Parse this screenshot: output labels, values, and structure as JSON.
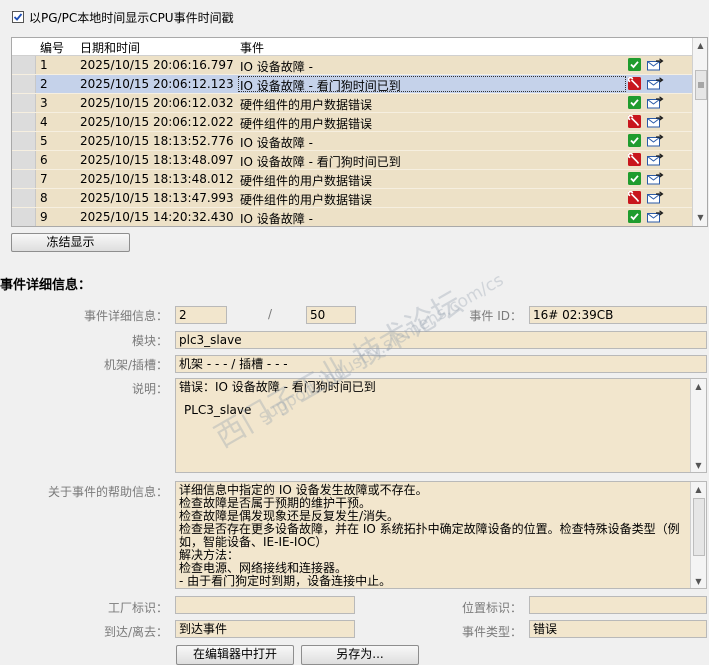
{
  "top_checkbox": {
    "label": "以PG/PC本地时间显示CPU事件时间戳",
    "checked": true
  },
  "table": {
    "columns": [
      "编号",
      "日期和时间",
      "事件"
    ],
    "selected_index": 1,
    "rows": [
      {
        "num": "1",
        "datetime": "2025/10/15 20:06:16.797",
        "event": "IO 设备故障 -",
        "status": "ok"
      },
      {
        "num": "2",
        "datetime": "2025/10/15 20:06:12.123",
        "event": "IO 设备故障 - 看门狗时间已到",
        "status": "error"
      },
      {
        "num": "3",
        "datetime": "2025/10/15 20:06:12.032",
        "event": "硬件组件的用户数据错误",
        "status": "ok"
      },
      {
        "num": "4",
        "datetime": "2025/10/15 20:06:12.022",
        "event": "硬件组件的用户数据错误",
        "status": "error"
      },
      {
        "num": "5",
        "datetime": "2025/10/15 18:13:52.776",
        "event": "IO 设备故障 -",
        "status": "ok"
      },
      {
        "num": "6",
        "datetime": "2025/10/15 18:13:48.097",
        "event": "IO 设备故障 - 看门狗时间已到",
        "status": "error"
      },
      {
        "num": "7",
        "datetime": "2025/10/15 18:13:48.012",
        "event": "硬件组件的用户数据错误",
        "status": "ok"
      },
      {
        "num": "8",
        "datetime": "2025/10/15 18:13:47.993",
        "event": "硬件组件的用户数据错误",
        "status": "error"
      },
      {
        "num": "9",
        "datetime": "2025/10/15 14:20:32.430",
        "event": "IO 设备故障 -",
        "status": "ok"
      }
    ]
  },
  "freeze_button": "冻结显示",
  "details": {
    "heading": "事件详细信息：",
    "detail_label": "事件详细信息：",
    "detail_index": "2",
    "slash": "/",
    "detail_total": "50",
    "event_id_label": "事件 ID：",
    "event_id": "16# 02:39CB",
    "module_label": "模块：",
    "module": "plc3_slave",
    "rack_label": "机架/插槽：",
    "rack": "机架 - - - / 插槽 - - -",
    "desc_label": "说明：",
    "desc_line1": "错误：IO 设备故障 - 看门狗时间已到",
    "desc_line2": "PLC3_slave",
    "help_label": "关于事件的帮助信息：",
    "help_lines": [
      "详细信息中指定的 IO 设备发生故障或不存在。",
      "检查故障是否属于预期的维护干预。",
      "检查故障是偶发现象还是反复发生/消失。",
      "检查是否存在更多设备故障，并在 IO 系统拓扑中确定故障设备的位置。检查特殊设备类型（例",
      "如，智能设备、IE-IE-IOC）",
      "解决方法：",
      "检查电源、网络接线和连接器。",
      "- 由于看门狗定时到期，设备连接中止。"
    ],
    "plant_label": "工厂标识：",
    "plant": "",
    "location_label": "位置标识：",
    "location": "",
    "arrive_label": "到达/离去：",
    "arrive": "到达事件",
    "type_label": "事件类型：",
    "type": "错误"
  },
  "buttons": {
    "open_editor": "在编辑器中打开",
    "save_as": "另存为..."
  },
  "watermark": {
    "line1": "西门子工业 技术论坛",
    "line2": "support.industry.siemens.com/cs"
  },
  "colors": {
    "ok": "#1f9c2e",
    "error": "#c8161d",
    "row_bg": "#ede1c7",
    "selected_bg": "#c5d2ea",
    "field_bg": "#f2e6cd"
  }
}
